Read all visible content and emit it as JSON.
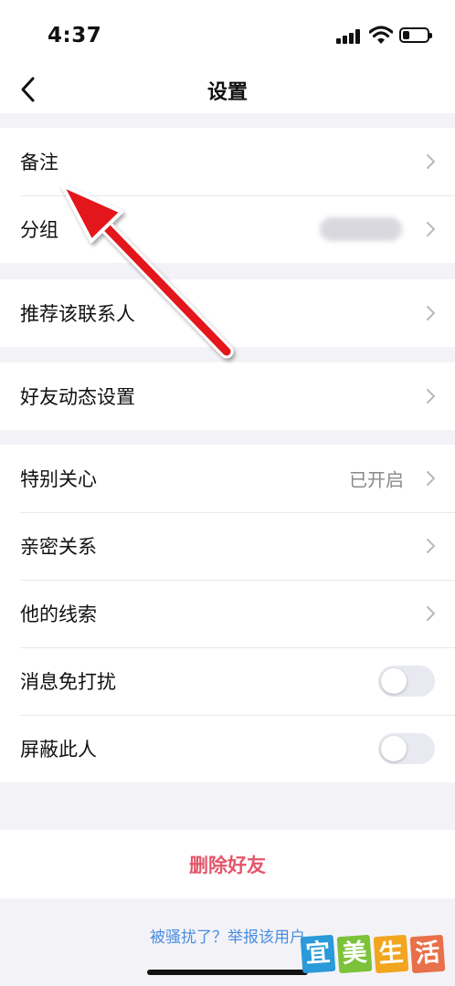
{
  "status_bar": {
    "time": "4:37"
  },
  "nav": {
    "title": "设置",
    "back_icon": "chevron-left-icon"
  },
  "rows": {
    "remark": {
      "label": "备注"
    },
    "group": {
      "label": "分组"
    },
    "recommend": {
      "label": "推荐该联系人"
    },
    "moments_settings": {
      "label": "好友动态设置"
    },
    "special_care": {
      "label": "特别关心",
      "value": "已开启"
    },
    "intimate": {
      "label": "亲密关系"
    },
    "clues": {
      "label": "他的线索"
    },
    "mute": {
      "label": "消息免打扰",
      "toggle_on": false
    },
    "block": {
      "label": "屏蔽此人",
      "toggle_on": false
    }
  },
  "actions": {
    "delete_label": "删除好友",
    "report_label": "被骚扰了？举报该用户"
  },
  "watermark": {
    "chars": [
      "宜",
      "美",
      "生",
      "活"
    ],
    "colors": [
      "#2a9ad9",
      "#7cc23a",
      "#f2a51f",
      "#e8704a"
    ]
  },
  "colors": {
    "delete": "#e3566a",
    "link": "#4a8de0",
    "annotation_arrow": "#e3141c",
    "background": "#f3f3f7"
  }
}
